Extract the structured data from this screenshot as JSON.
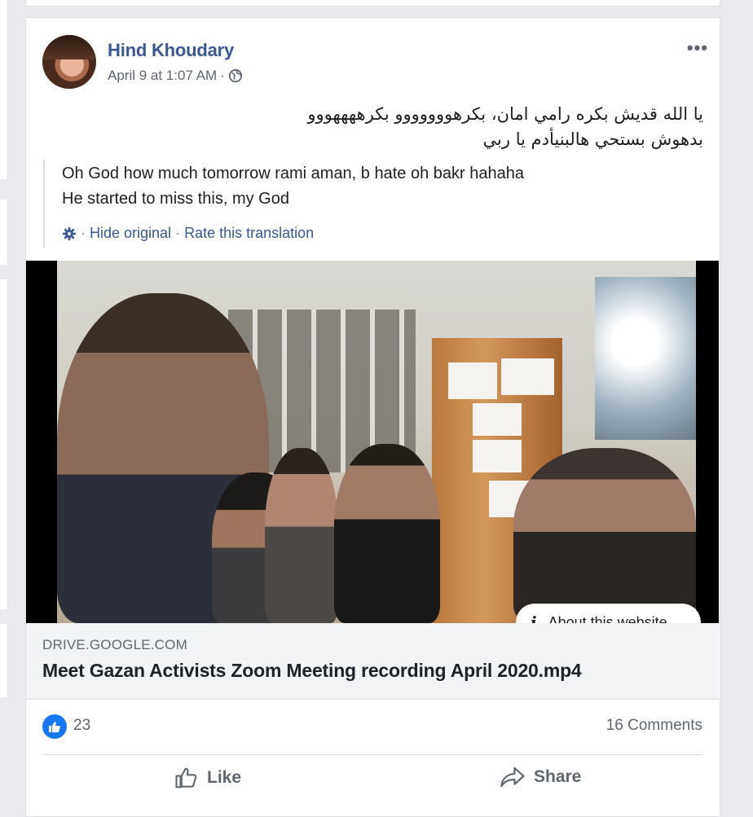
{
  "post": {
    "author": "Hind Khoudary",
    "timestamp": "April 9 at 1:07 AM",
    "separator": "·",
    "privacy_icon": "globe-icon",
    "more_icon": "ellipsis-icon",
    "text_lines": [
      "يا الله قديش بكره رامي امان، بكرهووووووو بكرههههووو",
      "بدهوش بستحي هالبنيأدم يا ربي"
    ]
  },
  "translation": {
    "lines": [
      "Oh God how much tomorrow rami aman, b hate oh bakr hahaha",
      "He started to miss this, my God"
    ],
    "hide_original": "Hide original",
    "separator": "·",
    "rate_translation": "Rate this translation",
    "settings_icon": "gear-icon"
  },
  "link_preview": {
    "about_website": "About this website",
    "domain": "DRIVE.GOOGLE.COM",
    "title": "Meet Gazan Activists Zoom Meeting recording April 2020.mp4"
  },
  "stats": {
    "like_count": "23",
    "comments": "16 Comments"
  },
  "actions": {
    "like": "Like",
    "share": "Share"
  },
  "colors": {
    "link_blue": "#385898",
    "like_blue": "#1877f2",
    "background": "#e9ebee"
  }
}
